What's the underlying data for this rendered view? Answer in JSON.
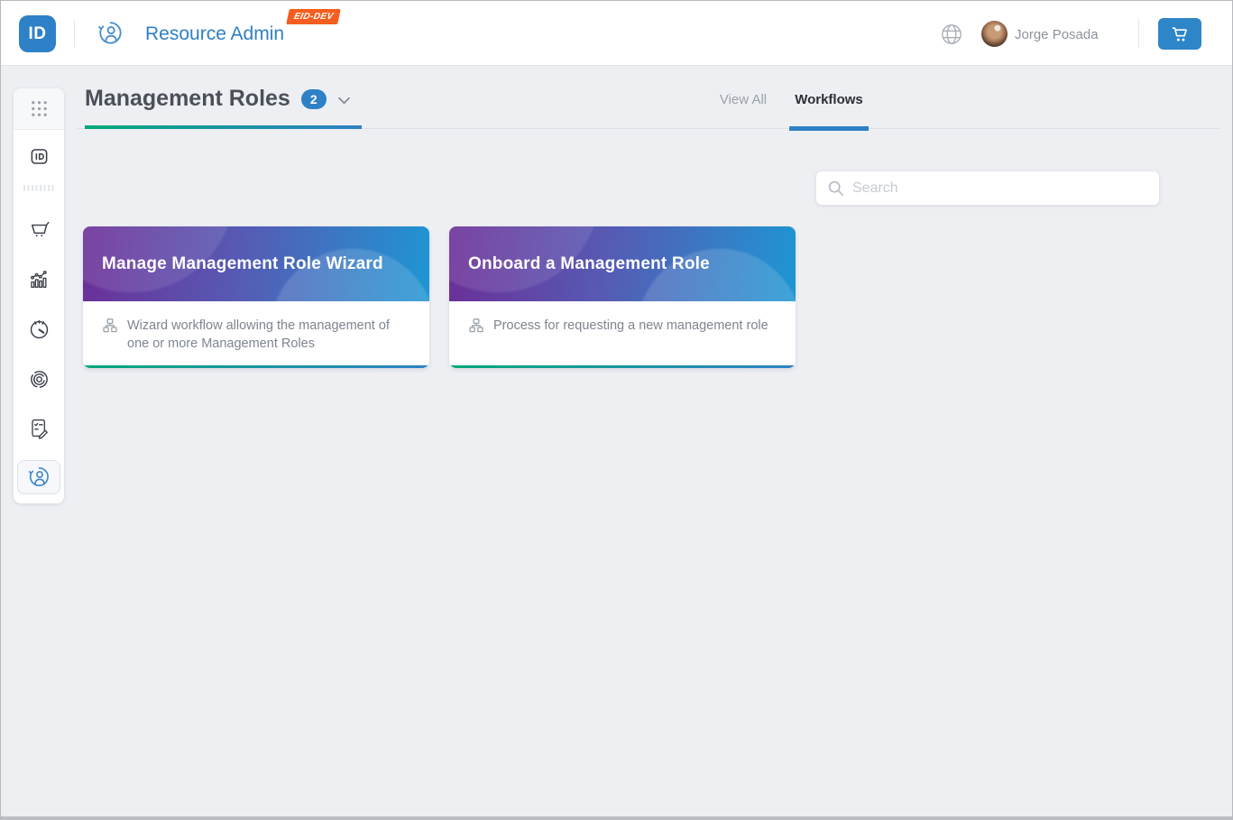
{
  "header": {
    "logo_text": "ID",
    "product_name": "Resource Admin",
    "env_badge": "EID-DEV",
    "user_name": "Jorge Posada"
  },
  "sidebar": {
    "items": [
      {
        "icon": "apps-grid-icon"
      },
      {
        "icon": "id-badge-icon"
      },
      {
        "icon": "dashes-placeholder"
      },
      {
        "icon": "cart-icon"
      },
      {
        "icon": "analytics-icon"
      },
      {
        "icon": "gauge-icon"
      },
      {
        "icon": "fingerprint-icon"
      },
      {
        "icon": "tasks-edit-icon"
      },
      {
        "icon": "user-sync-icon",
        "active": true
      }
    ]
  },
  "content": {
    "title": "Management Roles",
    "count": "2",
    "tabs": [
      {
        "label": "View All",
        "active": false
      },
      {
        "label": "Workflows",
        "active": true
      }
    ],
    "search": {
      "placeholder": "Search"
    },
    "cards": [
      {
        "title": "Manage Management Role Wizard",
        "description": "Wizard workflow allowing the management of one or more Management Roles",
        "icon": "org-chart-icon"
      },
      {
        "title": "Onboard a Management Role",
        "description": "Process for requesting a new management role",
        "icon": "org-chart-icon"
      }
    ]
  },
  "colors": {
    "accent_blue": "#2e81c6",
    "badge_orange": "#f65e1f",
    "underline_gradient_start": "#00a97a",
    "underline_gradient_end": "#2e81c6",
    "card_gradient": [
      "#6b2e97",
      "#565bb4",
      "#1e96d3"
    ],
    "page_background": "#edeff3"
  }
}
